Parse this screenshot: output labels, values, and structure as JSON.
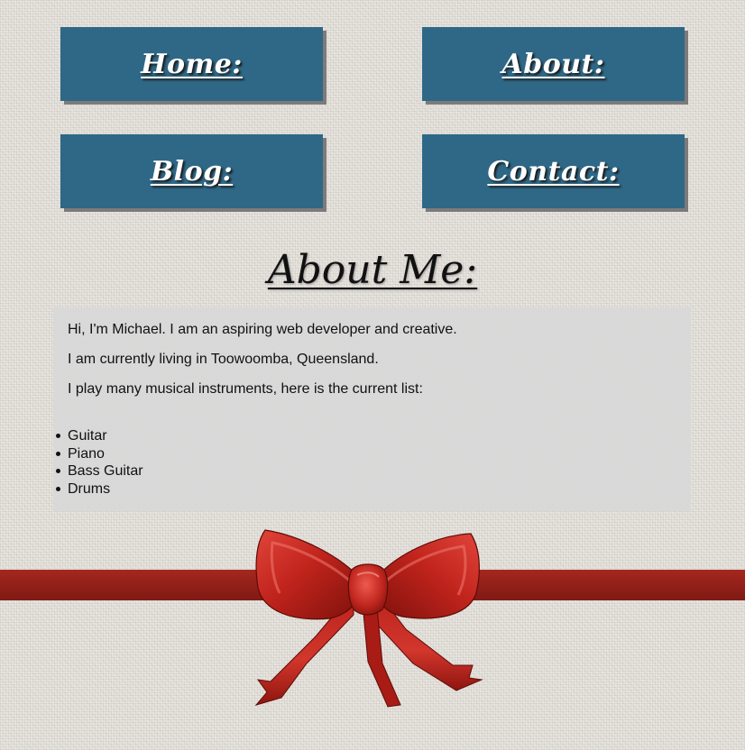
{
  "nav": {
    "home": "Home:",
    "about": "About:",
    "blog": "Blog:",
    "contact": "Contact:"
  },
  "page_title": "About Me:",
  "content": {
    "paragraphs": [
      "Hi, I'm Michael. I am an aspiring web developer and creative.",
      "I am currently living in Toowoomba, Queensland.",
      "I play many musical instruments, here is the current list:"
    ],
    "instruments": [
      "Guitar",
      "Piano",
      "Bass Guitar",
      "Drums"
    ]
  },
  "decoration": {
    "icon": "red-ribbon-bow-icon",
    "ribbon_color": "#922019",
    "nav_color": "#2e6886"
  }
}
